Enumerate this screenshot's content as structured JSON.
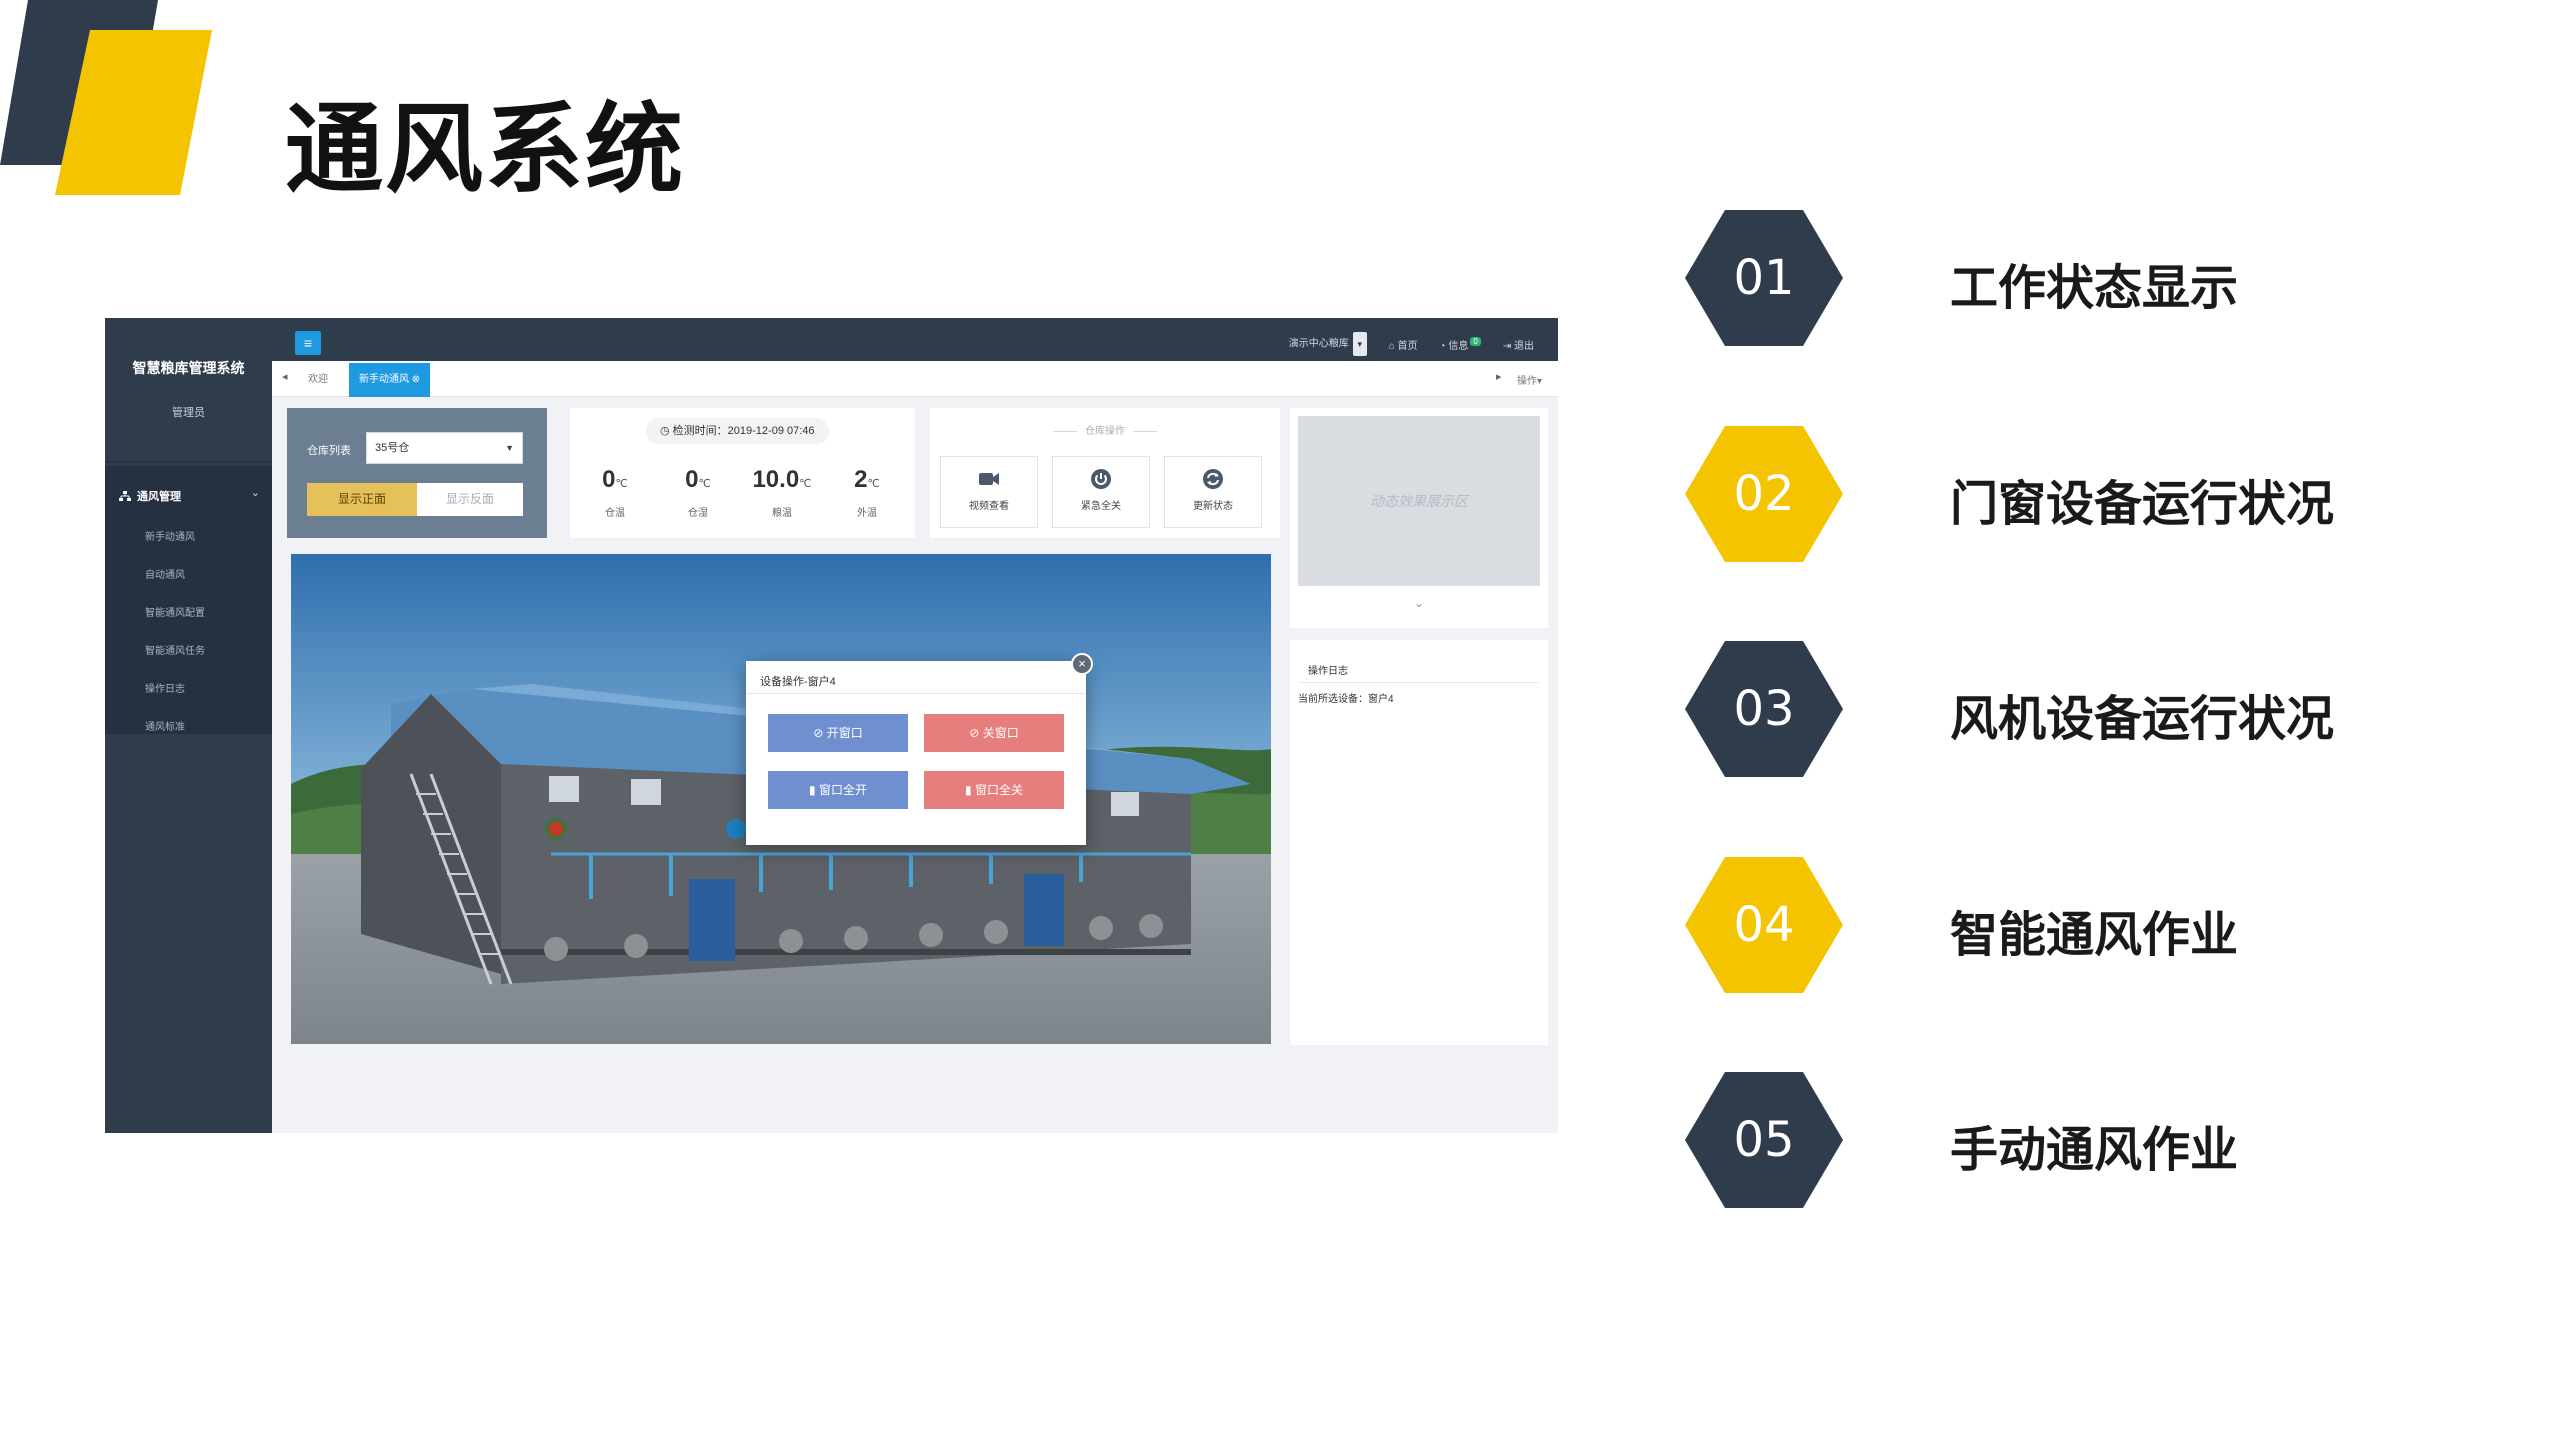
{
  "slide": {
    "title": "通风系统",
    "colors": {
      "navy": "#2f3c4c",
      "yellow": "#f5c400"
    }
  },
  "app": {
    "brand": "智慧粮库管理系统",
    "user_role": "管理员",
    "sidebar": {
      "group_label": "通风管理",
      "items": [
        {
          "label": "新手动通风"
        },
        {
          "label": "自动通风"
        },
        {
          "label": "智能通风配置"
        },
        {
          "label": "智能通风任务"
        },
        {
          "label": "操作日志"
        },
        {
          "label": "通风标准"
        }
      ]
    },
    "topbar": {
      "menu_icon": "≡",
      "warehouse_select": "演示中心粮库",
      "home": "首页",
      "messages": "信息",
      "messages_count": "0",
      "logout": "退出"
    },
    "tabs": {
      "welcome": "欢迎",
      "active": "新手动通风",
      "ops": "操作"
    },
    "warehouse_panel": {
      "list_label": "仓库列表",
      "selected": "35号仓",
      "show_front": "显示正面",
      "show_back": "显示反面"
    },
    "readings": {
      "time": "检测时间：2019-12-09 07:46",
      "items": [
        {
          "value": "0",
          "unit": "℃",
          "label": "仓温"
        },
        {
          "value": "0",
          "unit": "℃",
          "label": "仓湿"
        },
        {
          "value": "10.0",
          "unit": "℃",
          "label": "粮温"
        },
        {
          "value": "2",
          "unit": "℃",
          "label": "外温"
        }
      ]
    },
    "ops_panel": {
      "title": "仓库操作",
      "buttons": [
        {
          "label": "视频查看",
          "icon": "video-icon"
        },
        {
          "label": "紧急全关",
          "icon": "power-icon"
        },
        {
          "label": "更新状态",
          "icon": "refresh-icon"
        }
      ]
    },
    "effect_area": "动态效果展示区",
    "log": {
      "title": "操作日志",
      "text": "当前所选设备：窗户4"
    },
    "modal": {
      "title": "设备操作-窗户4",
      "open_window": "开窗口",
      "close_window": "关窗口",
      "open_all": "窗口全开",
      "close_all": "窗口全关"
    }
  },
  "features": [
    {
      "num": "01",
      "label": "工作状态显示",
      "color": "navy"
    },
    {
      "num": "02",
      "label": "门窗设备运行状况",
      "color": "yellow"
    },
    {
      "num": "03",
      "label": "风机设备运行状况",
      "color": "navy"
    },
    {
      "num": "04",
      "label": "智能通风作业",
      "color": "yellow"
    },
    {
      "num": "05",
      "label": "手动通风作业",
      "color": "navy"
    }
  ]
}
